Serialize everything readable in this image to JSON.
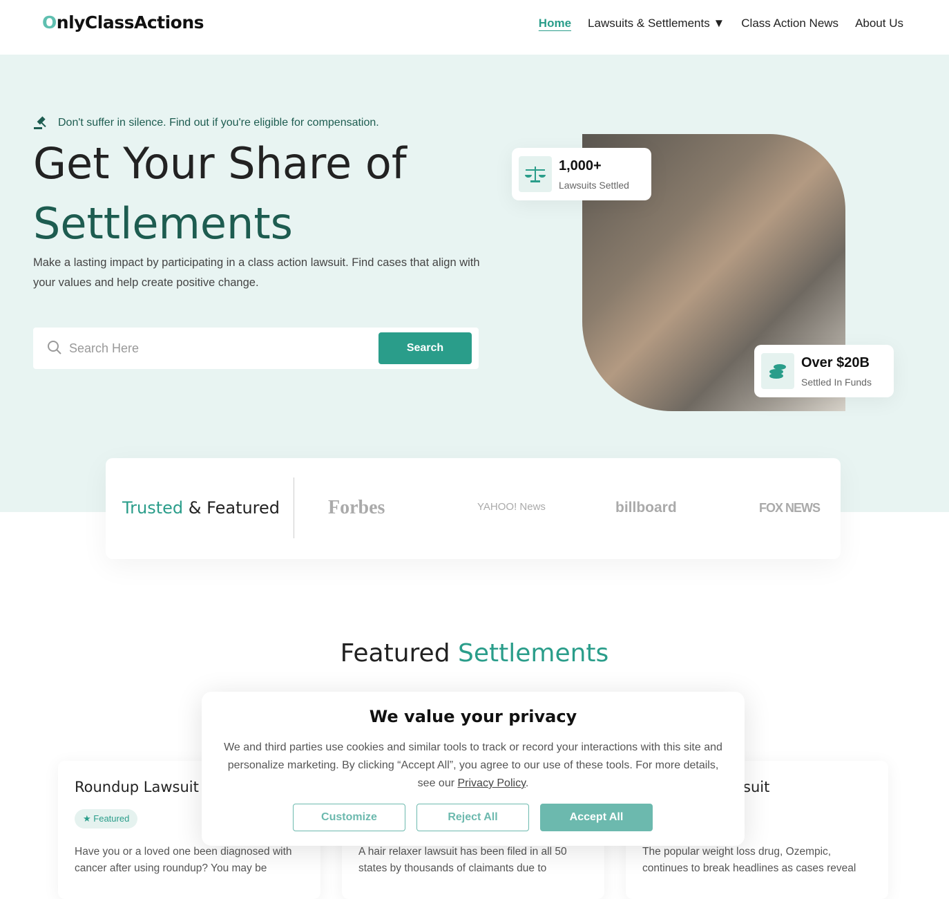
{
  "nav": {
    "logo_first": "O",
    "logo_rest": "nlyClassActions",
    "items": [
      "Home",
      "Lawsuits & Settlements ▼",
      "Class Action News",
      "About Us"
    ]
  },
  "hero": {
    "tagline": "Don't suffer in silence. Find out if you're eligible for compensation.",
    "title_line1": "Get Your Share of",
    "title_line2": "Settlements",
    "lead": "Make a lasting impact by participating in a class action lawsuit. Find cases that align with your values and help create positive change.",
    "search_placeholder": "Search Here",
    "search_button": "Search"
  },
  "stats": [
    {
      "value": "1,000+",
      "label": "Lawsuits Settled",
      "icon": "scales-icon"
    },
    {
      "value": "Over $20B",
      "label": "Settled In Funds",
      "icon": "coins-icon"
    }
  ],
  "trusted": {
    "accent": "Trusted",
    "rest": " & Featured",
    "brands": [
      "Forbes",
      "YAHOO! News",
      "billboard",
      "FOX NEWS"
    ]
  },
  "featured": {
    "title_dark": "Featured ",
    "title_accent": "Settlements"
  },
  "cards": [
    {
      "title": "Roundup Lawsuit",
      "badge": "Featured",
      "text": "Have you or a loved one been diagnosed with cancer after using roundup? You may be"
    },
    {
      "title": "",
      "text": "A hair relaxer lawsuit has been filed in all 50 states by thousands of claimants due to"
    },
    {
      "title": "suit",
      "text": "The popular weight loss drug, Ozempic, continues to break headlines as cases reveal"
    }
  ],
  "cookie": {
    "title": "We value your privacy",
    "text": "We and third parties use cookies and similar tools to track or record your interactions with this site and personalize marketing. By clicking “Accept All”, you agree to our use of these tools. For more details, see our ",
    "link": "Privacy Policy",
    "end": ".",
    "customize": "Customize",
    "reject": "Reject All",
    "accept": "Accept All"
  },
  "colors": {
    "accent": "#2a9d8a",
    "dark_green": "#1d5c50",
    "hero_bg": "#e8f4f2"
  }
}
